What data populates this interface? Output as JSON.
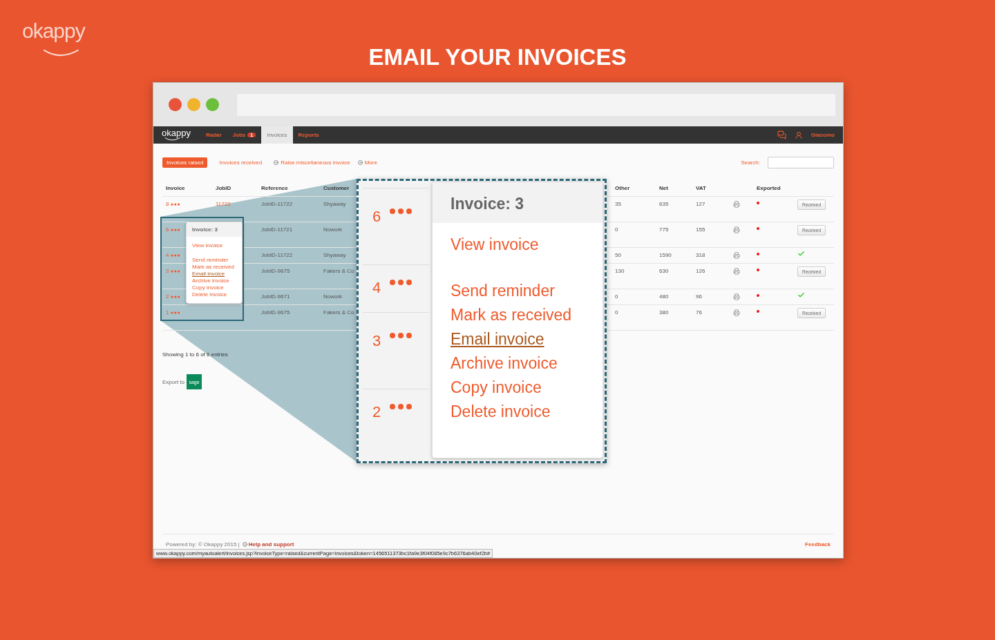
{
  "brand": {
    "logo": "okappy",
    "headline": "EMAIL YOUR INVOICES"
  },
  "navbar": {
    "logo": "okappy",
    "items": [
      {
        "label": "Radar",
        "selected": false
      },
      {
        "label": "Jobs",
        "badge": "1",
        "selected": false
      },
      {
        "label": "Invoices",
        "selected": true
      },
      {
        "label": "Reports",
        "selected": false
      }
    ],
    "user": "Giacomo"
  },
  "subnav": {
    "tabs": [
      {
        "label": "Invoices raised",
        "selected": true
      },
      {
        "label": "Invoices received",
        "selected": false
      }
    ],
    "actions": [
      "Raise miscellaneous invoice",
      "More"
    ],
    "search": {
      "label": "Search:"
    }
  },
  "table": {
    "columns": [
      "Invoice",
      "JobID",
      "Reference",
      "Customer",
      "Other",
      "Net",
      "VAT",
      "Exported"
    ],
    "rows": [
      {
        "invoice": "8",
        "job_id": "11722",
        "reference": "JobID-11722",
        "customer": "Shyaway",
        "other": "35",
        "net": "635",
        "vat": "127",
        "exported": false,
        "status": {
          "kind": "button",
          "label": "Received"
        }
      },
      {
        "invoice": "6",
        "reference": "JobID-11721",
        "customer": "Nowork",
        "other": "0",
        "net": "775",
        "vat": "155",
        "exported": false,
        "status": {
          "kind": "button",
          "label": "Received"
        }
      },
      {
        "invoice": "4",
        "reference": "JobID-11722",
        "customer": "Shyaway",
        "other": "50",
        "net": "1590",
        "vat": "318",
        "exported": false,
        "status": {
          "kind": "check"
        }
      },
      {
        "invoice": "3",
        "reference": "JobID-9675",
        "customer": "Fakers & Co",
        "other": "130",
        "net": "630",
        "vat": "126",
        "exported": false,
        "status": {
          "kind": "button",
          "label": "Received"
        }
      },
      {
        "invoice": "2",
        "reference": "JobID-9671",
        "customer": "Nowork",
        "other": "0",
        "net": "480",
        "vat": "96",
        "exported": false,
        "status": {
          "kind": "check"
        }
      },
      {
        "invoice": "1",
        "reference": "JobID-9675",
        "customer": "Fakers & Co",
        "other": "0",
        "net": "380",
        "vat": "76",
        "exported": false,
        "status": {
          "kind": "button",
          "label": "Received"
        }
      }
    ]
  },
  "row_menu": {
    "title": "Invoice: 3",
    "groups": [
      [
        {
          "label": "View invoice",
          "highlighted": false
        }
      ],
      [
        {
          "label": "Send reminder",
          "highlighted": false
        },
        {
          "label": "Mark as received",
          "highlighted": false
        },
        {
          "label": "Email invoice",
          "highlighted": true
        },
        {
          "label": "Archive invoice",
          "highlighted": false
        },
        {
          "label": "Copy invoice",
          "highlighted": false
        },
        {
          "label": "Delete invoice",
          "highlighted": false
        }
      ]
    ]
  },
  "zoom": {
    "rows": [
      {
        "invoice": "6"
      },
      {
        "invoice": "4"
      },
      {
        "invoice": "3"
      },
      {
        "invoice": "2"
      }
    ],
    "menu": {
      "title": "Invoice: 3",
      "groups": [
        [
          {
            "label": "View invoice",
            "highlighted": false
          }
        ],
        [
          {
            "label": "Send reminder",
            "highlighted": false
          },
          {
            "label": "Mark as received",
            "highlighted": false
          },
          {
            "label": "Email invoice",
            "highlighted": true
          },
          {
            "label": "Archive invoice",
            "highlighted": false
          },
          {
            "label": "Copy invoice",
            "highlighted": false
          },
          {
            "label": "Delete invoice",
            "highlighted": false
          }
        ]
      ]
    }
  },
  "footer": {
    "summary": "Showing 1 to 6 of 6 entries",
    "export_label": "Export to",
    "export_button": "sage",
    "powered_by": "Powered by: © Okappy 2015 |",
    "help": "Help and support",
    "feedback": "Feedback",
    "status_url": "www.okappy.com/myautoalert/invoices.jsp?invoiceType=raised&currentPage=invoices&token=1456511373bc1fa9e3f04f085e9c7b6376ab40ef2b#"
  }
}
